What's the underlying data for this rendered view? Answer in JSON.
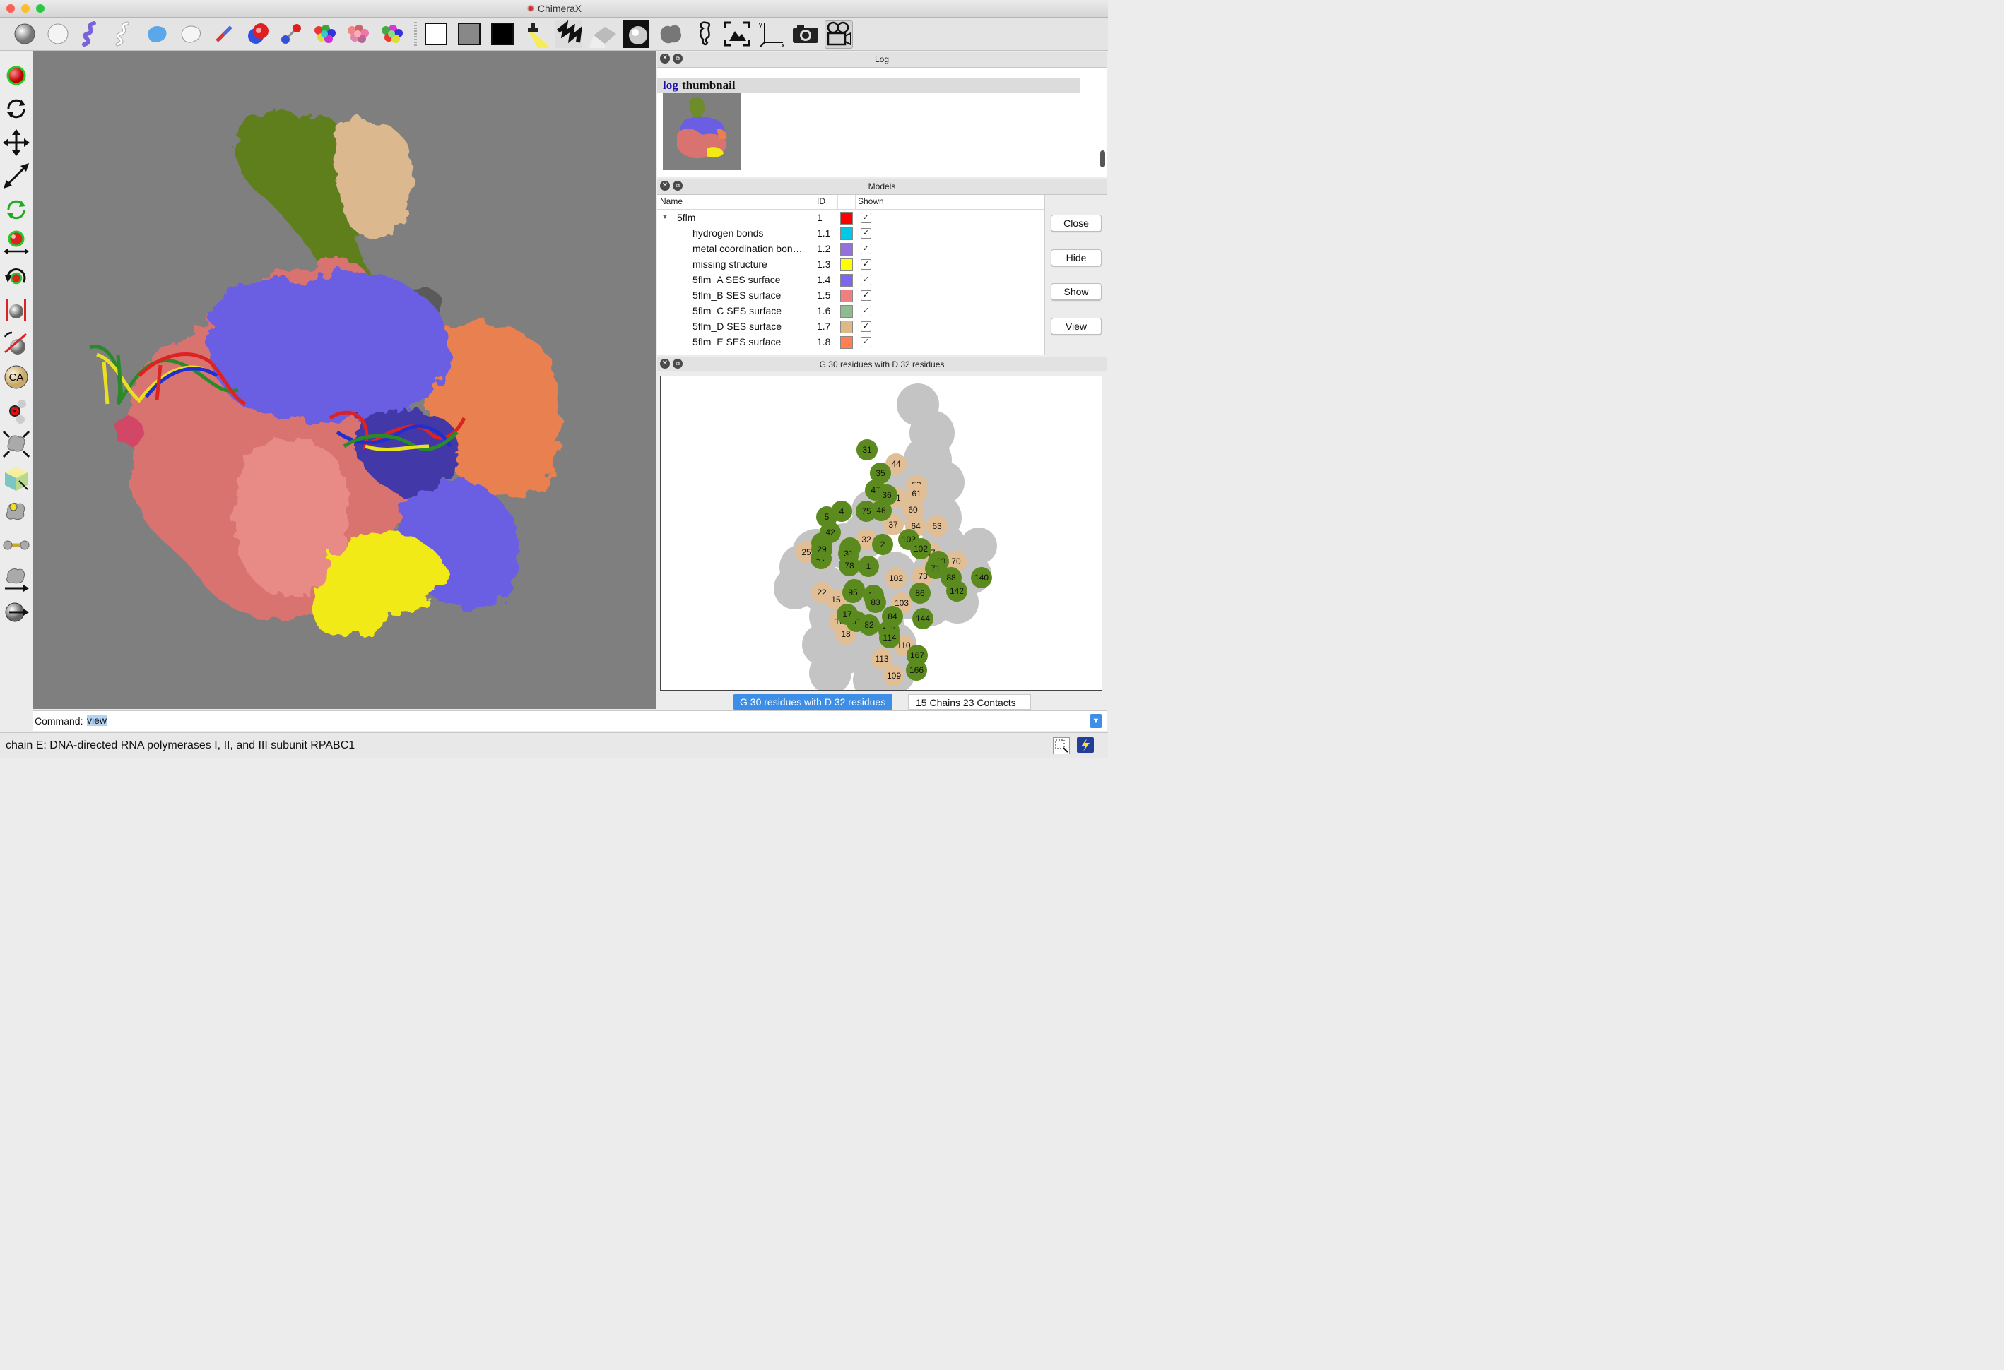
{
  "window": {
    "title": "ChimeraX"
  },
  "toolbar": {
    "icons": [
      "ball-icon",
      "sphere-outline-icon",
      "cartoon-ribbon-icon",
      "ribbon-outline-icon",
      "blob-surface-icon",
      "surface-outline-icon",
      "stick-icon",
      "atom-sphere-icon",
      "ball-and-stick-icon",
      "color-atoms-icon",
      "color-chains-icon",
      "color-polymers-icon",
      "white-background-icon",
      "gray-background-icon",
      "black-background-icon",
      "simple-lighting-icon",
      "soft-lighting-icon",
      "full-lighting-icon",
      "flat-lighting-icon",
      "shadow-icon",
      "surface-blob-icon",
      "seahorse-icon",
      "view-all-icon",
      "axes-icon",
      "camera-icon",
      "movie-camera-icon"
    ]
  },
  "left_tools": [
    "select-mode-icon",
    "rotate-mode-icon",
    "translate-mode-icon",
    "zoom-mode-icon",
    "rotate-select-mode-icon",
    "distance-mode-icon",
    "swapaa-icon",
    "clip-mode-icon",
    "label-atom-icon",
    "CA",
    "pick-blob-icon",
    "move-picked-icon",
    "translate-picked-icon",
    "crop-box-icon",
    "place-marker-icon",
    "bond-rotate-icon",
    "tug-icon",
    "play-coords-icon"
  ],
  "log": {
    "panel_title": "Log",
    "link_text": "log",
    "heading_text": "thumbnail"
  },
  "models": {
    "panel_title": "Models",
    "columns": [
      "Name",
      "ID",
      "",
      "Shown"
    ],
    "rows": [
      {
        "name": "5flm",
        "id": "1",
        "color": "#ff0000",
        "shown": true,
        "indent": 0,
        "expander": "▼"
      },
      {
        "name": "hydrogen bonds",
        "id": "1.1",
        "color": "#00c8e6",
        "shown": true,
        "indent": 1
      },
      {
        "name": "metal coordination bon…",
        "id": "1.2",
        "color": "#9370db",
        "shown": true,
        "indent": 1
      },
      {
        "name": "missing structure",
        "id": "1.3",
        "color": "#ffff00",
        "shown": true,
        "indent": 1
      },
      {
        "name": "5flm_A SES surface",
        "id": "1.4",
        "color": "#7b68ee",
        "shown": true,
        "indent": 1
      },
      {
        "name": "5flm_B SES surface",
        "id": "1.5",
        "color": "#f08080",
        "shown": true,
        "indent": 1
      },
      {
        "name": "5flm_C SES surface",
        "id": "1.6",
        "color": "#8fbc8f",
        "shown": true,
        "indent": 1
      },
      {
        "name": "5flm_D SES surface",
        "id": "1.7",
        "color": "#deb887",
        "shown": true,
        "indent": 1
      },
      {
        "name": "5flm_E SES surface",
        "id": "1.8",
        "color": "#ff7f50",
        "shown": true,
        "indent": 1
      }
    ],
    "buttons": [
      "Close",
      "Hide",
      "Show",
      "View"
    ]
  },
  "contacts": {
    "panel_title": "G 30 residues with D 32 residues",
    "green_color": "#5b8a1e",
    "tan_color": "#e2be94",
    "green_residues": [
      "31",
      "35",
      "47",
      "36",
      "4",
      "5",
      "42",
      "30",
      "41",
      "75",
      "46",
      "3",
      "31",
      "78",
      "1",
      "2",
      "103",
      "102",
      "100",
      "71",
      "88",
      "140",
      "142",
      "86",
      "144",
      "84",
      "146",
      "114",
      "167",
      "166",
      "80",
      "95",
      "99",
      "83",
      "81",
      "82",
      "17",
      "29"
    ],
    "tan_residues": [
      "44",
      "58",
      "61",
      "41",
      "60",
      "37",
      "64",
      "63",
      "32",
      "25",
      "26",
      "73",
      "70",
      "102",
      "67",
      "22",
      "15",
      "103",
      "16",
      "18",
      "110",
      "113",
      "109",
      "48"
    ]
  },
  "tabs": {
    "active": "G 30 residues with D 32 residues",
    "inactive": "15 Chains 23 Contacts"
  },
  "command": {
    "label": "Command:",
    "value": "view"
  },
  "status": {
    "text": "chain E: DNA-directed RNA polymerases I, II, and III subunit RPABC1"
  }
}
